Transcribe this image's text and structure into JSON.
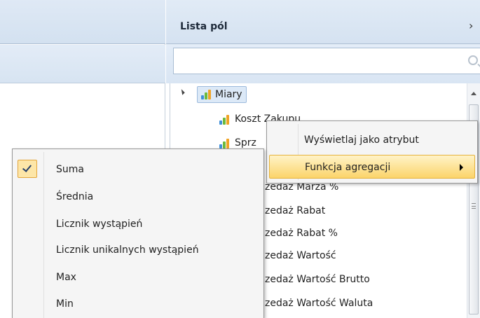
{
  "field_list": {
    "title": "Lista pól",
    "collapse_glyph": "›",
    "search_placeholder": "",
    "root": {
      "label": "Miary",
      "expander": "expanded-triangle-icon"
    },
    "visible_items": [
      {
        "label": "Koszt Zakupu"
      },
      {
        "label": "Sprz"
      }
    ],
    "partially_visible_items": [
      "zedaż Marża %",
      "zedaż Rabat",
      "zedaż Rabat %",
      "zedaż Wartość",
      "zedaż Wartość Brutto",
      "zedaż Wartość Waluta"
    ]
  },
  "context_menu": {
    "items": [
      {
        "label": "Wyświetlaj jako atrybut",
        "highlighted": false
      },
      {
        "label": "Funkcja agregacji",
        "highlighted": true,
        "has_submenu": true
      }
    ]
  },
  "aggregation_submenu": {
    "items": [
      {
        "label": "Suma",
        "checked": true
      },
      {
        "label": "Średnia",
        "checked": false
      },
      {
        "label": "Licznik wystąpień",
        "checked": false
      },
      {
        "label": "Licznik unikalnych wystąpień",
        "checked": false
      },
      {
        "label": "Max",
        "checked": false
      },
      {
        "label": "Min",
        "checked": false
      }
    ]
  },
  "colors": {
    "highlight": "#fbd46a",
    "bar_blue": "#3f8fd8",
    "bar_green": "#6cba3c",
    "bar_orange": "#f0a325"
  }
}
